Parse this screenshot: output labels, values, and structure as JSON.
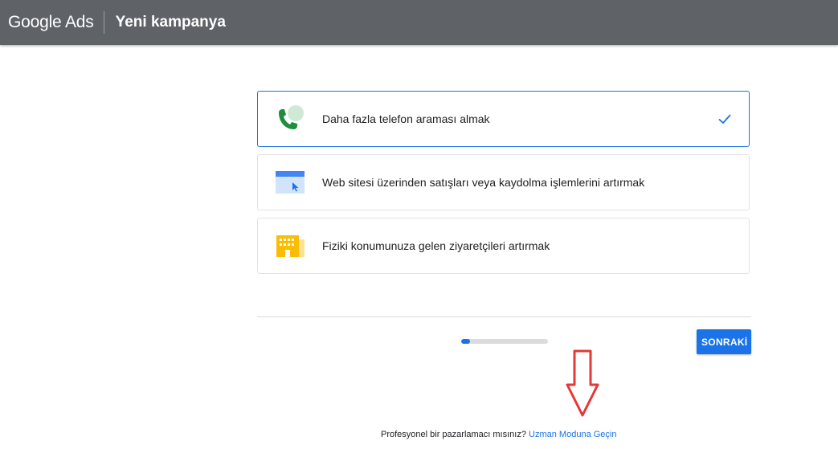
{
  "header": {
    "brand": "Google Ads",
    "title": "Yeni kampanya"
  },
  "goals": [
    {
      "label": "Daha fazla telefon araması almak",
      "icon": "phone-call-icon",
      "selected": true
    },
    {
      "label": "Web sitesi üzerinden satışları veya kaydolma işlemlerini artırmak",
      "icon": "website-icon",
      "selected": false
    },
    {
      "label": "Fiziki konumunuza gelen ziyaretçileri artırmak",
      "icon": "building-icon",
      "selected": false
    }
  ],
  "progress": {
    "fraction": 0.1
  },
  "next_button": "SONRAKİ",
  "footer": {
    "question": "Profesyonel bir pazarlamacı mısınız?",
    "link": "Uzman Moduna Geçin"
  },
  "colors": {
    "header_bg": "#5f6368",
    "accent": "#1a73e8",
    "arrow": "#e53935"
  }
}
